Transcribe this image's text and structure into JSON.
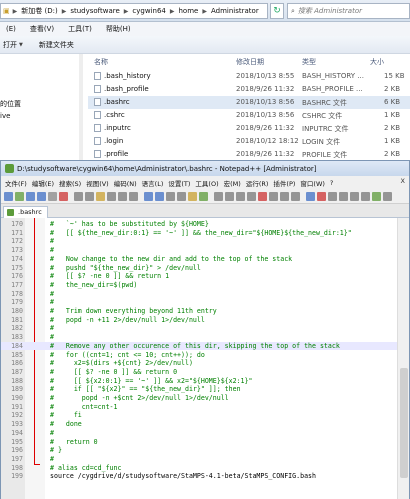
{
  "explorer": {
    "breadcrumb": [
      "新加卷 (D:)",
      "studysoftware",
      "cygwin64",
      "home",
      "Administrator"
    ],
    "search_placeholder": "搜索 Administrator",
    "menu": [
      "(E)",
      "查看(V)",
      "工具(T)",
      "帮助(H)"
    ],
    "toolbar": [
      "打开",
      "新建文件夹"
    ],
    "nav_labels": [
      "的位置",
      "ive"
    ],
    "columns": {
      "name": "名称",
      "date": "修改日期",
      "type": "类型",
      "size": "大小"
    },
    "files": [
      {
        "name": ".bash_history",
        "date": "2018/10/13 8:55",
        "type": "BASH_HISTORY ...",
        "size": "15 KB"
      },
      {
        "name": ".bash_profile",
        "date": "2018/9/26 11:32",
        "type": "BASH_PROFILE ...",
        "size": "2 KB"
      },
      {
        "name": ".bashrc",
        "date": "2018/10/13 8:56",
        "type": "BASHRC 文件",
        "size": "6 KB"
      },
      {
        "name": ".cshrc",
        "date": "2018/10/13 8:56",
        "type": "CSHRC 文件",
        "size": "1 KB"
      },
      {
        "name": ".inputrc",
        "date": "2018/9/26 11:32",
        "type": "INPUTRC 文件",
        "size": "2 KB"
      },
      {
        "name": ".login",
        "date": "2018/10/12 18:12",
        "type": "LOGIN 文件",
        "size": "1 KB"
      },
      {
        "name": ".profile",
        "date": "2018/9/26 11:32",
        "type": "PROFILE 文件",
        "size": "2 KB"
      }
    ]
  },
  "npp": {
    "title": "D:\\studysoftware\\cygwin64\\home\\Administrator\\.bashrc - Notepad++ [Administrator]",
    "menu": [
      "文件(F)",
      "编辑(E)",
      "搜索(S)",
      "视图(V)",
      "编码(N)",
      "语言(L)",
      "设置(T)",
      "工具(O)",
      "宏(M)",
      "运行(R)",
      "插件(P)",
      "窗口(W)",
      "?"
    ],
    "close_glyph": "X",
    "tab_label": ".bashrc",
    "lines": [
      {
        "num": "170",
        "text": "#   `~' has to be substituted by ${HOME}",
        "cls": "c-comment"
      },
      {
        "num": "171",
        "text": "#   [[ ${the_new_dir:0:1} == '~' ]] && the_new_dir=\"${HOME}${the_new_dir:1}\"",
        "cls": "c-comment"
      },
      {
        "num": "172",
        "text": "#",
        "cls": "c-comment"
      },
      {
        "num": "173",
        "text": "#",
        "cls": "c-comment"
      },
      {
        "num": "174",
        "text": "#   Now change to the new dir and add to the top of the stack",
        "cls": "c-comment"
      },
      {
        "num": "175",
        "text": "#   pushd \"${the_new_dir}\" > /dev/null",
        "cls": "c-comment"
      },
      {
        "num": "176",
        "text": "#   [[ $? -ne 0 ]] && return 1",
        "cls": "c-comment"
      },
      {
        "num": "177",
        "text": "#   the_new_dir=$(pwd)",
        "cls": "c-comment"
      },
      {
        "num": "178",
        "text": "#",
        "cls": "c-comment"
      },
      {
        "num": "179",
        "text": "#",
        "cls": "c-comment"
      },
      {
        "num": "180",
        "text": "#   Trim down everything beyond 11th entry",
        "cls": "c-comment"
      },
      {
        "num": "181",
        "text": "#   popd -n +11 2>/dev/null 1>/dev/null",
        "cls": "c-comment"
      },
      {
        "num": "182",
        "text": "#",
        "cls": "c-comment"
      },
      {
        "num": "183",
        "text": "#",
        "cls": "c-comment"
      },
      {
        "num": "184",
        "text": "#   Remove any other occurence of this dir, skipping the top of the stack",
        "cls": "c-comment"
      },
      {
        "num": "185",
        "text": "#   for ((cnt=1; cnt <= 10; cnt++)); do",
        "cls": "c-comment"
      },
      {
        "num": "186",
        "text": "#     x2=$(dirs +${cnt} 2>/dev/null)",
        "cls": "c-comment"
      },
      {
        "num": "187",
        "text": "#     [[ $? -ne 0 ]] && return 0",
        "cls": "c-comment"
      },
      {
        "num": "188",
        "text": "#     [[ ${x2:0:1} == '~' ]] && x2=\"${HOME}${x2:1}\"",
        "cls": "c-comment"
      },
      {
        "num": "189",
        "text": "#     if [[ \"${x2}\" == \"${the_new_dir}\" ]]; then",
        "cls": "c-comment"
      },
      {
        "num": "190",
        "text": "#       popd -n +$cnt 2>/dev/null 1>/dev/null",
        "cls": "c-comment"
      },
      {
        "num": "191",
        "text": "#       cnt=cnt-1",
        "cls": "c-comment"
      },
      {
        "num": "192",
        "text": "#     fi",
        "cls": "c-comment"
      },
      {
        "num": "193",
        "text": "#   done",
        "cls": "c-comment"
      },
      {
        "num": "194",
        "text": "#",
        "cls": "c-comment"
      },
      {
        "num": "195",
        "text": "#   return 0",
        "cls": "c-comment"
      },
      {
        "num": "196",
        "text": "# }",
        "cls": "c-comment"
      },
      {
        "num": "197",
        "text": "#",
        "cls": "c-comment"
      },
      {
        "num": "198",
        "text": "# alias cd=cd_func",
        "cls": "c-comment"
      },
      {
        "num": "199",
        "text": "source /cygdrive/d/studysoftware/StaMPS-4.1-beta/StaMPS_CONFIG.bash",
        "cls": "c-plain"
      }
    ]
  }
}
